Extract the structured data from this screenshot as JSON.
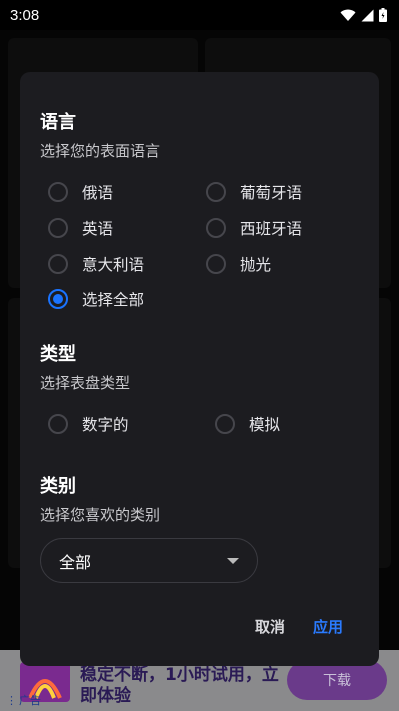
{
  "status_bar": {
    "time": "3:08",
    "icons": [
      "wifi-icon",
      "signal-icon",
      "battery-icon"
    ]
  },
  "dialog": {
    "language": {
      "title": "语言",
      "subtitle": "选择您的表面语言",
      "options": [
        {
          "label": "俄语",
          "checked": false
        },
        {
          "label": "葡萄牙语",
          "checked": false
        },
        {
          "label": "英语",
          "checked": false
        },
        {
          "label": "西班牙语",
          "checked": false
        },
        {
          "label": "意大利语",
          "checked": false
        },
        {
          "label": "抛光",
          "checked": false
        },
        {
          "label": "选择全部",
          "checked": true
        }
      ]
    },
    "type": {
      "title": "类型",
      "subtitle": "选择表盘类型",
      "options": [
        {
          "label": "数字的",
          "checked": false
        },
        {
          "label": "模拟",
          "checked": false
        }
      ]
    },
    "category": {
      "title": "类别",
      "subtitle": "选择您喜欢的类别",
      "selected": "全部"
    },
    "cancel_label": "取消",
    "apply_label": "应用"
  },
  "ad": {
    "label": "广告",
    "text": "稳定不断，1小时试用，立即体验",
    "button_label": "下载"
  },
  "colors": {
    "accent": "#1a73ff",
    "dialog_bg": "#1c1c20",
    "ad_bg": "#8a8a8c"
  }
}
